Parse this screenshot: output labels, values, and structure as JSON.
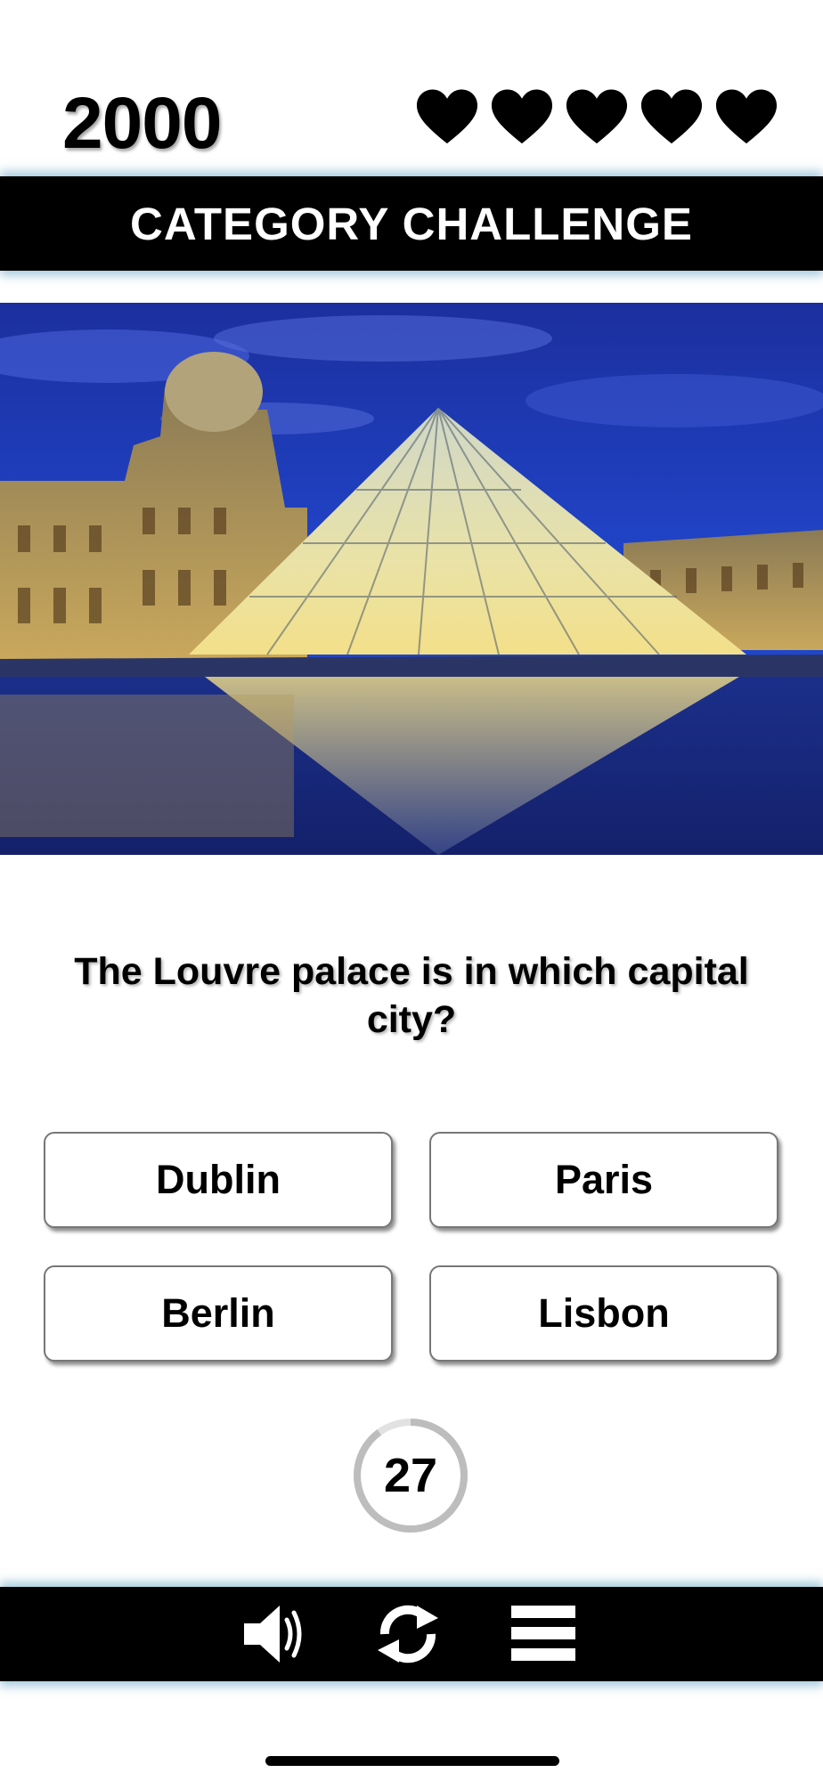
{
  "score": "2000",
  "lives": {
    "count": 5,
    "icon": "heart-icon",
    "color": "#000000"
  },
  "title": "CATEGORY CHALLENGE",
  "image": {
    "subject": "louvre-pyramid-photo"
  },
  "question": "The Louvre palace is in which capital city?",
  "answers": [
    "Dublin",
    "Paris",
    "Berlin",
    "Lisbon"
  ],
  "timer": {
    "value": "27",
    "remaining_fraction": 0.9
  },
  "toolbar": {
    "sound_icon": "speaker-icon",
    "refresh_icon": "refresh-icon",
    "menu_icon": "menu-icon"
  },
  "colors": {
    "bar": "#000000",
    "bar_glow": "#6eaac8",
    "sky": "#1a3fc0"
  }
}
